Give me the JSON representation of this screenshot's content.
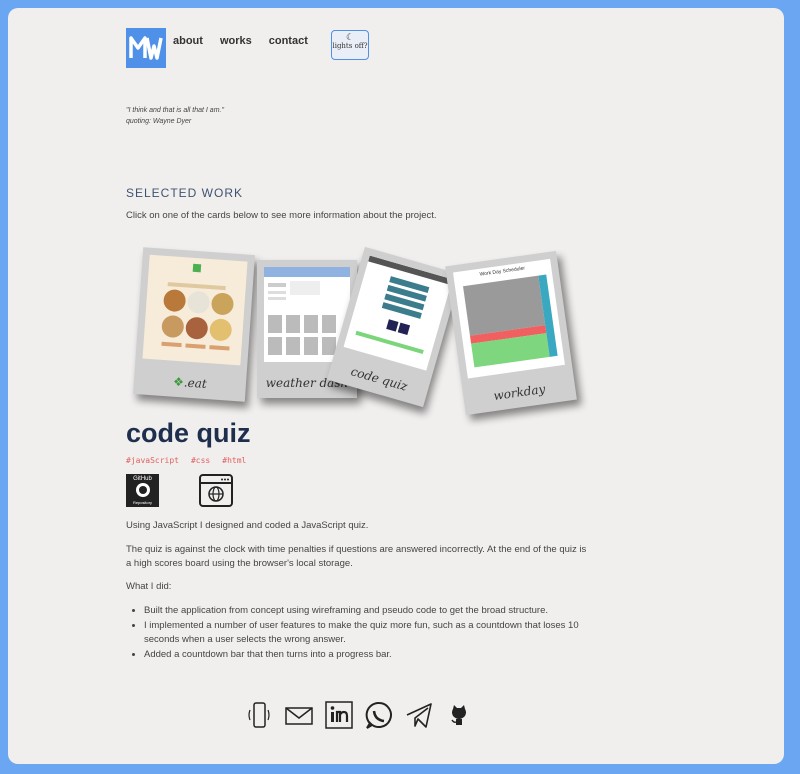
{
  "nav": {
    "logo": "MW",
    "links": [
      "about",
      "works",
      "contact"
    ],
    "toggle_label": "lights off?"
  },
  "quote": {
    "text": "\"I think and that is all that I am.\"",
    "author": "quoting: Wayne Dyer"
  },
  "works": {
    "title": "SELECTED WORK",
    "subtitle": "Click on one of the cards below to see more information about the project.",
    "cards": [
      {
        "caption": ".eat"
      },
      {
        "caption": "weather dash"
      },
      {
        "caption": "code quiz"
      },
      {
        "caption": "workday"
      }
    ],
    "workday_header": "Work Day Scheduler"
  },
  "project": {
    "title": "code quiz",
    "tags": [
      "#javaScript",
      "#css",
      "#html"
    ],
    "github_label": "GitHub",
    "github_sub": "Repository",
    "intro": "Using JavaScript I designed and coded a JavaScript quiz.",
    "details": "The quiz is against the clock with time penalties if questions are answered incorrectly. At the end of the quiz is a high scores board using the browser's local storage.",
    "what_label": "What I did:",
    "bullets": [
      "Built the application from concept using wireframing and pseudo code to get the broad structure.",
      "I implemented a number of user features to make the quiz more fun, such as a countdown that loses 10 seconds when a user selects the wrong answer.",
      "Added a countdown bar that then turns into a progress bar."
    ]
  },
  "footer": {
    "icons": [
      "phone-icon",
      "mail-icon",
      "linkedin-icon",
      "whatsapp-icon",
      "telegram-icon",
      "github-icon"
    ]
  }
}
